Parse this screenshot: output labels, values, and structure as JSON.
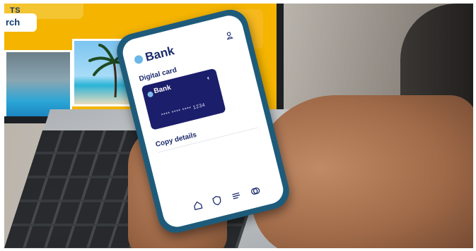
{
  "laptop": {
    "promo_text": "TS",
    "search_label": "rch",
    "next_arrow": "›"
  },
  "phone": {
    "app_name": "Bank",
    "section_title": "Digital card",
    "card": {
      "bank_name": "Bank",
      "number_masked": "**** **** **** 1234",
      "contactless_symbol": "◖"
    },
    "copy_details_label": "Copy details",
    "nav_icons": [
      "home-icon",
      "shield-icon",
      "list-icon",
      "gift-icon"
    ]
  },
  "colors": {
    "card_blue": "#1b1e6b",
    "brand_text": "#1a2a6c",
    "phone_case": "#1e5b7a",
    "laptop_accent": "#f4b400"
  }
}
